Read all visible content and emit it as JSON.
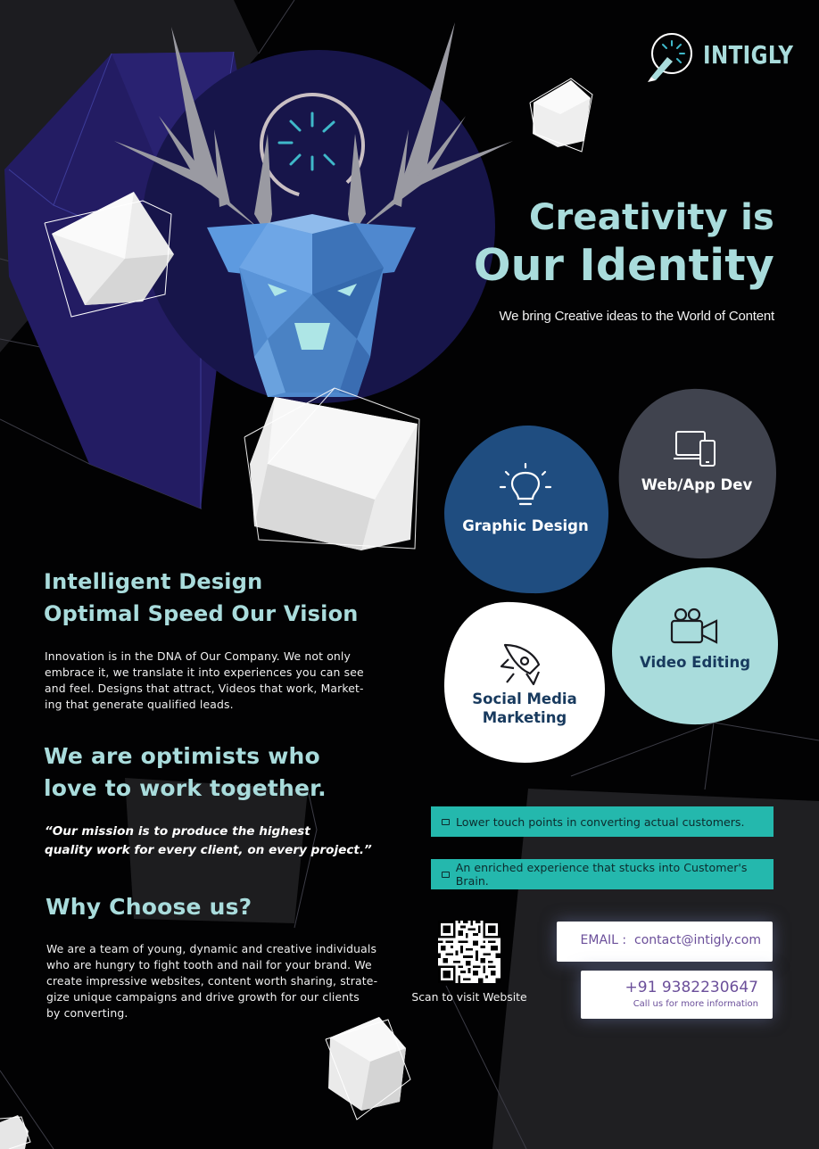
{
  "brand": {
    "name": "INTIGLY"
  },
  "hero": {
    "title_line1": "Creativity is",
    "title_line2": "Our Identity",
    "subtitle": "We bring Creative ideas to the World of Content"
  },
  "services": [
    {
      "label": "Graphic Design",
      "icon": "lightbulb-icon",
      "color": "#1f4d80"
    },
    {
      "label": "Web/App Dev",
      "icon": "devices-icon",
      "color": "#40434e"
    },
    {
      "label_line1": "Social Media",
      "label_line2": "Marketing",
      "icon": "rocket-icon",
      "color": "#ffffff"
    },
    {
      "label": "Video Editing",
      "icon": "video-camera-icon",
      "color": "#a9dcdc"
    }
  ],
  "vision": {
    "heading_line1": "Intelligent Design",
    "heading_line2": "Optimal Speed Our Vision",
    "paragraph_lines": [
      "Innovation is in the DNA of Our Company. We not only",
      "embrace it, we translate it into experiences you can see",
      "and feel. Designs that attract, Videos that work, Market-",
      "ing that generate qualified leads."
    ]
  },
  "optimists": {
    "heading_line1": "We are optimists who",
    "heading_line2": "love to work together.",
    "quote_line1": "“Our mission is to produce the highest",
    "quote_line2": "quality work for every client, on every project.”"
  },
  "why": {
    "heading": "Why Choose us?",
    "paragraph_lines": [
      "We are a team of young, dynamic and creative individuals",
      "who are hungry to fight tooth and nail for your brand. We",
      "create impressive websites, content worth sharing, strate-",
      "gize unique campaigns and drive growth for our clients",
      "by converting."
    ]
  },
  "highlights": [
    "Lower touch points in converting actual customers.",
    "An enriched experience that stucks into Customer's Brain."
  ],
  "qr": {
    "caption": "Scan to visit Website"
  },
  "contact": {
    "email_label": "EMAIL :",
    "email": "contact@intigly.com",
    "phone": "+91 9382230647",
    "phone_note": "Call us for more information"
  },
  "colors": {
    "accent_teal": "#a9dcdc",
    "bar_teal": "#24b8ad",
    "deer_blue": "#4d84c7",
    "circle_navy": "#18164a",
    "contact_purple": "#6b4f9a"
  }
}
